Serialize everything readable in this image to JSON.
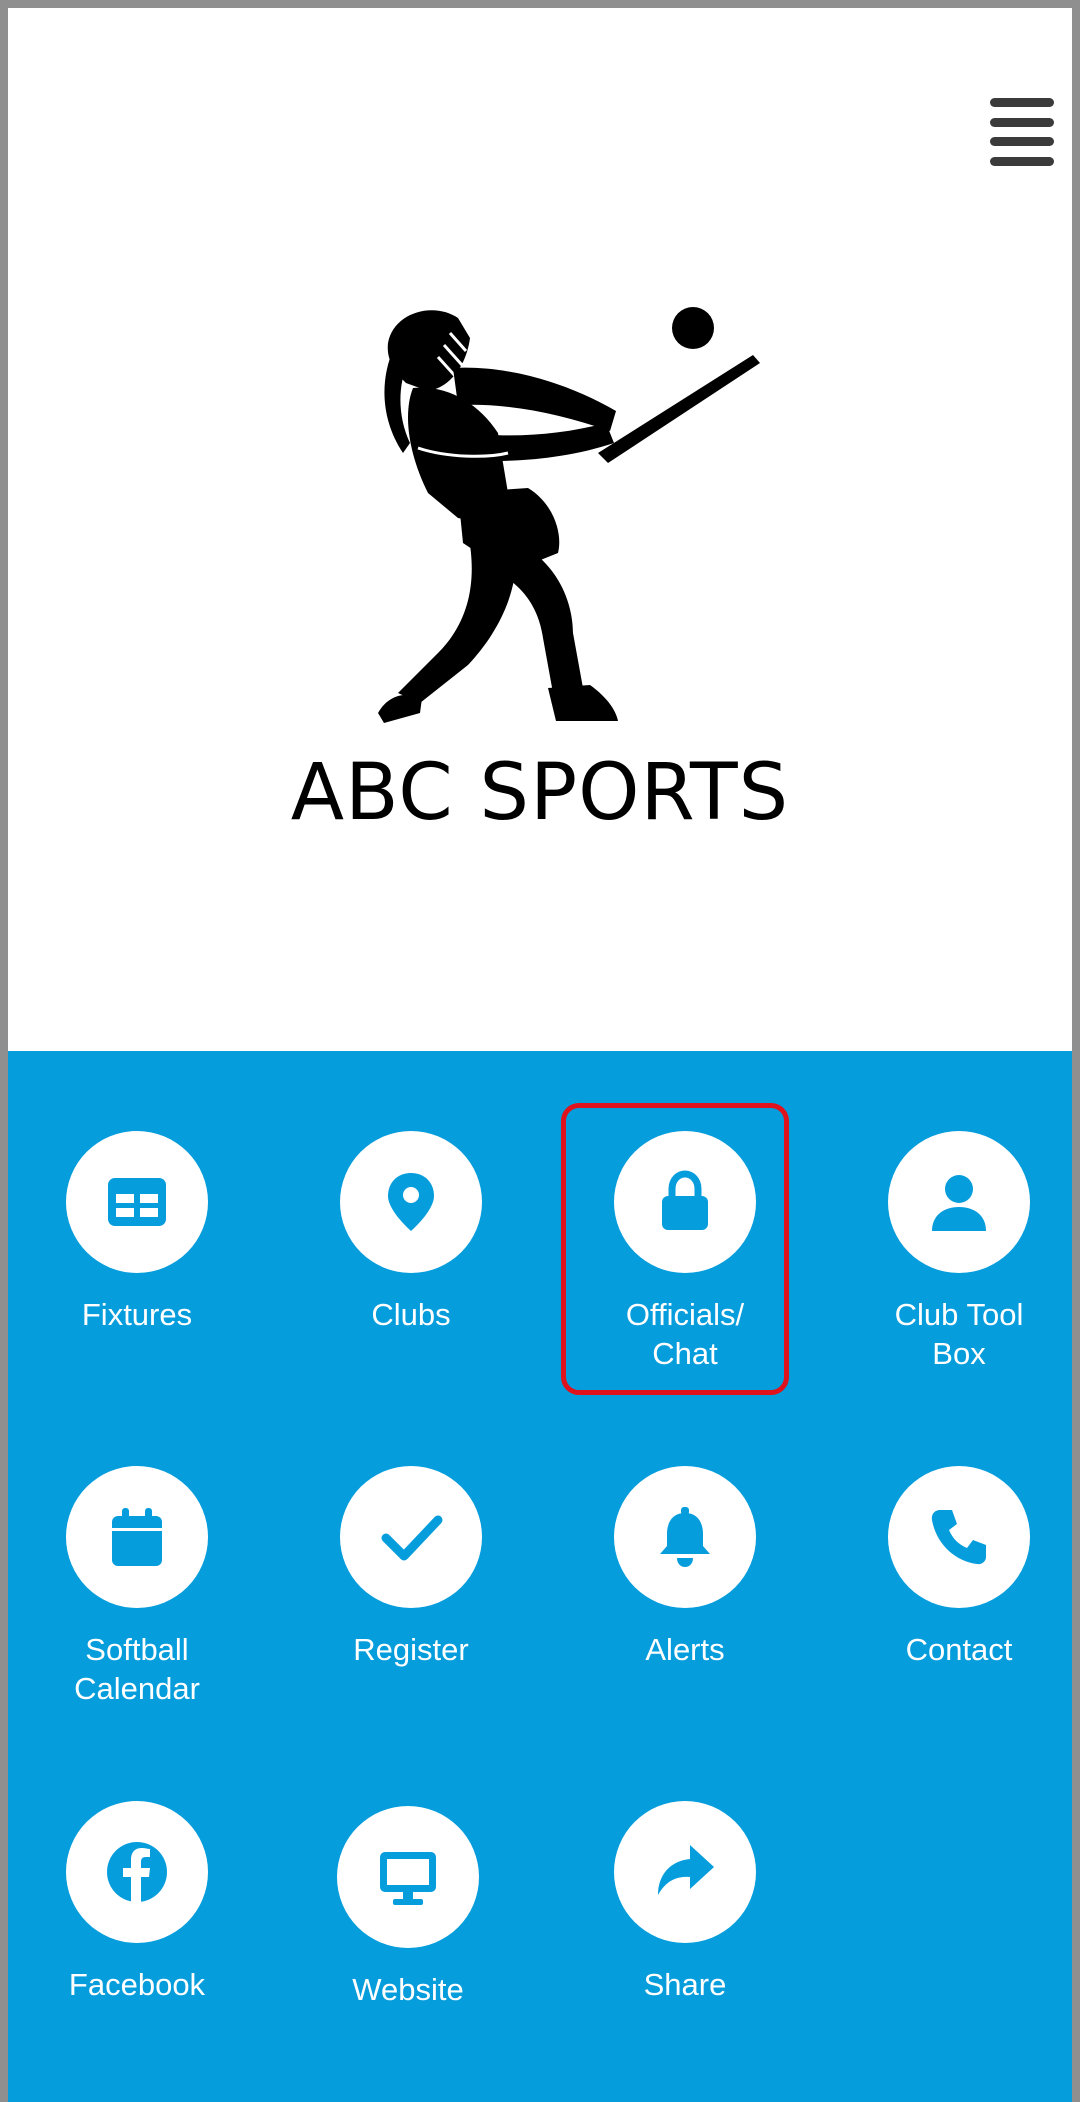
{
  "header": {
    "title": "ABC SPORTS",
    "menu_icon": "hamburger-menu-icon",
    "logo": "softball-batter-silhouette"
  },
  "menu": {
    "accent_color": "#069ddd",
    "highlight_color": "#e0121b",
    "items": [
      {
        "label": "Fixtures",
        "icon": "fixtures-table-icon"
      },
      {
        "label": "Clubs",
        "icon": "map-pin-icon"
      },
      {
        "label": "Officials/\nChat",
        "icon": "lock-icon",
        "highlighted": true
      },
      {
        "label": "Club Tool\nBox",
        "icon": "user-icon"
      },
      {
        "label": "Softball\nCalendar",
        "icon": "calendar-icon"
      },
      {
        "label": "Register",
        "icon": "checkmark-icon"
      },
      {
        "label": "Alerts",
        "icon": "bell-icon"
      },
      {
        "label": "Contact",
        "icon": "phone-icon"
      },
      {
        "label": "Facebook",
        "icon": "facebook-icon"
      },
      {
        "label": "Website",
        "icon": "monitor-icon"
      },
      {
        "label": "Share",
        "icon": "share-arrow-icon"
      }
    ]
  }
}
